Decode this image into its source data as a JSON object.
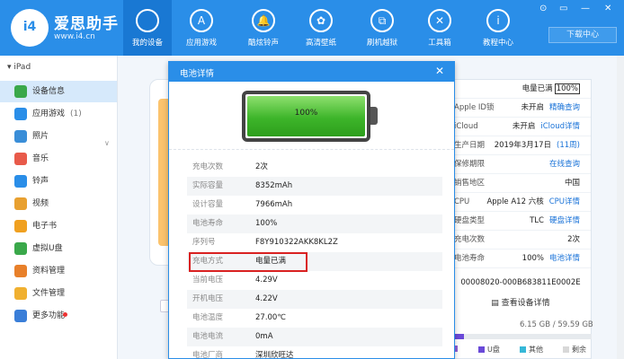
{
  "header": {
    "brand_name": "爱思助手",
    "brand_url": "www.i4.cn",
    "logo_text": "i4",
    "nav": [
      {
        "label": "我的设备",
        "icon": "apple-icon",
        "glyph": "",
        "active": true
      },
      {
        "label": "应用游戏",
        "icon": "app-store-icon",
        "glyph": "A",
        "active": false
      },
      {
        "label": "酷炫铃声",
        "icon": "bell-icon",
        "glyph": "🔔",
        "active": false
      },
      {
        "label": "高清壁纸",
        "icon": "flower-icon",
        "glyph": "✿",
        "active": false
      },
      {
        "label": "刷机越狱",
        "icon": "box-icon",
        "glyph": "⧉",
        "active": false
      },
      {
        "label": "工具箱",
        "icon": "tools-icon",
        "glyph": "✕",
        "active": false
      },
      {
        "label": "教程中心",
        "icon": "info-icon",
        "glyph": "i",
        "active": false
      }
    ],
    "download_center": "下载中心",
    "window_controls": [
      "⊙",
      "▭",
      "—",
      "✕"
    ]
  },
  "sidebar": {
    "device_name": "iPad",
    "device_arrow": "▾",
    "items": [
      {
        "label": "设备信息",
        "count": "",
        "icon": "info-circle-icon",
        "color": "#3aa84a",
        "active": true
      },
      {
        "label": "应用游戏",
        "count": "(1)",
        "icon": "app-store-icon",
        "color": "#2a8ee8",
        "active": false
      },
      {
        "label": "照片",
        "count": "",
        "icon": "photo-icon",
        "color": "#3a8ed8",
        "active": false
      },
      {
        "label": "音乐",
        "count": "",
        "icon": "music-icon",
        "color": "#e85a4a",
        "active": false
      },
      {
        "label": "铃声",
        "count": "",
        "icon": "bell-icon",
        "color": "#2a8ee8",
        "active": false
      },
      {
        "label": "视频",
        "count": "",
        "icon": "video-icon",
        "color": "#e8a030",
        "active": false
      },
      {
        "label": "电子书",
        "count": "",
        "icon": "book-icon",
        "color": "#f0a020",
        "active": false
      },
      {
        "label": "虚拟U盘",
        "count": "",
        "icon": "usb-icon",
        "color": "#3aa84a",
        "active": false
      },
      {
        "label": "资料管理",
        "count": "",
        "icon": "contacts-icon",
        "color": "#e8802a",
        "active": false
      },
      {
        "label": "文件管理",
        "count": "",
        "icon": "folder-icon",
        "color": "#f0b030",
        "active": false
      },
      {
        "label": "更多功能",
        "count": "",
        "icon": "grid-icon",
        "color": "#3a7ed8",
        "active": false
      }
    ]
  },
  "info_panel": {
    "rows": [
      {
        "key": "",
        "value": "电量已满",
        "badge": "100%",
        "link": ""
      },
      {
        "key": "Apple ID锁",
        "value": "未开启",
        "link": "精确查询"
      },
      {
        "key": "iCloud",
        "value": "未开启",
        "link": "iCloud详情"
      },
      {
        "key": "生产日期",
        "value": "2019年3月17日",
        "link": "(11周)"
      },
      {
        "key": "保修期限",
        "value": "",
        "link": "在线查询"
      },
      {
        "key": "销售地区",
        "value": "中国",
        "link": ""
      },
      {
        "key": "CPU",
        "value": "Apple A12 六核",
        "link": "CPU详情"
      },
      {
        "key": "硬盘类型",
        "value": "TLC",
        "link": "硬盘详情"
      },
      {
        "key": "充电次数",
        "value": "2次",
        "link": ""
      },
      {
        "key": "电池寿命",
        "value": "100%",
        "link": "电池详情"
      }
    ],
    "serial": "00008020-000B683811E0002E",
    "view_details": "查看设备详情",
    "view_details_icon": "list-icon",
    "storage": "6.15 GB / 59.59 GB",
    "storage_fill": 0.103,
    "legend": [
      {
        "label": "",
        "color": "#8e5fd8"
      },
      {
        "label": "U盘",
        "color": "#6a4ad8"
      },
      {
        "label": "其他",
        "color": "#36b8d8"
      },
      {
        "label": "剩余",
        "color": "#d8d8d8"
      }
    ]
  },
  "dialog": {
    "title": "电池详情",
    "close": "✕",
    "battery_level": "100%",
    "battery_fill": 1.0,
    "rows": [
      {
        "key": "充电次数",
        "value": "2次"
      },
      {
        "key": "实际容量",
        "value": "8352mAh"
      },
      {
        "key": "设计容量",
        "value": "7966mAh"
      },
      {
        "key": "电池寿命",
        "value": "100%"
      },
      {
        "key": "序列号",
        "value": "F8Y910322AKK8KL2Z"
      },
      {
        "key": "充电方式",
        "value": "电量已满"
      },
      {
        "key": "当前电压",
        "value": "4.29V"
      },
      {
        "key": "开机电压",
        "value": "4.22V"
      },
      {
        "key": "电池温度",
        "value": "27.00℃"
      },
      {
        "key": "电池电流",
        "value": "0mA"
      },
      {
        "key": "电池厂商",
        "value": "深圳欣旺达"
      }
    ]
  }
}
